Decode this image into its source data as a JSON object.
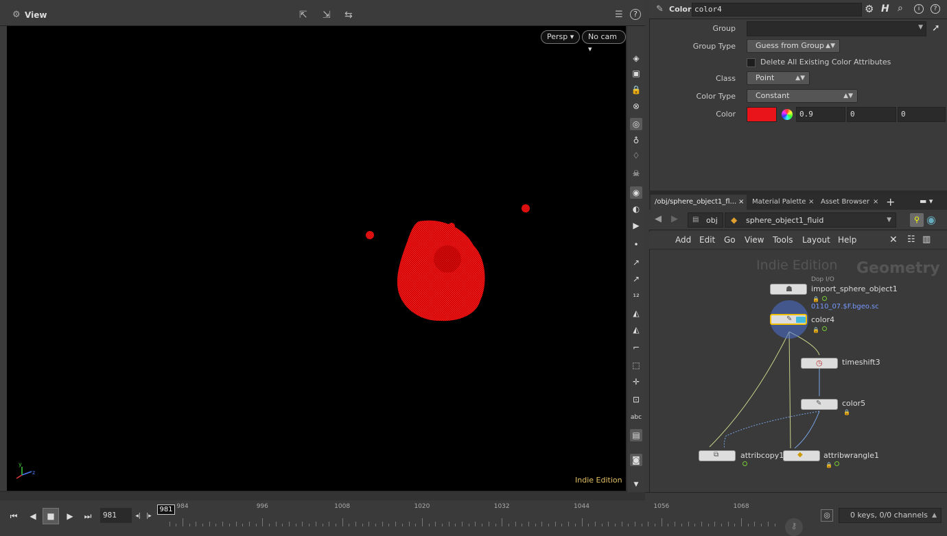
{
  "viewer": {
    "title": "View",
    "persp_label": "Persp",
    "cam_label": "No cam",
    "watermark": "Indie Edition"
  },
  "timeline": {
    "current_frame": "981",
    "frame_field": "981",
    "ticks": [
      "984",
      "996",
      "1008",
      "1020",
      "1032",
      "1044",
      "1056",
      "1068"
    ],
    "keys_status": "0 keys, 0/0 channels"
  },
  "params": {
    "node_type": "Color",
    "node_name": "color4",
    "group_label": "Group",
    "group_value": "",
    "group_type_label": "Group Type",
    "group_type_value": "Guess from Group",
    "delete_attrs_label": "Delete All Existing Color Attributes",
    "class_label": "Class",
    "class_value": "Point",
    "color_type_label": "Color Type",
    "color_type_value": "Constant",
    "color_label": "Color",
    "color_swatch": "#e8141a",
    "color_r": "0.9",
    "color_g": "0",
    "color_b": "0"
  },
  "network": {
    "tabs": [
      {
        "label": "/obj/sphere_object1_fl..."
      },
      {
        "label": "Material Palette"
      },
      {
        "label": "Asset Browser"
      }
    ],
    "path_root": "obj",
    "path_node": "sphere_object1_fluid",
    "menu": [
      "Add",
      "Edit",
      "Go",
      "View",
      "Tools",
      "Layout",
      "Help"
    ],
    "watermark_edition": "Indie Edition",
    "watermark_context": "Geometry",
    "nodes": {
      "import_tag": "Dop I/O",
      "import": "import_sphere_object1",
      "import_file": "0110_07.$F.bgeo.sc",
      "color4": "color4",
      "timeshift": "timeshift3",
      "color5": "color5",
      "attribcopy": "attribcopy1",
      "attribwrangle": "attribwrangle1"
    }
  },
  "colors": {
    "selection": "#f0c000",
    "blob": "#d01010"
  }
}
